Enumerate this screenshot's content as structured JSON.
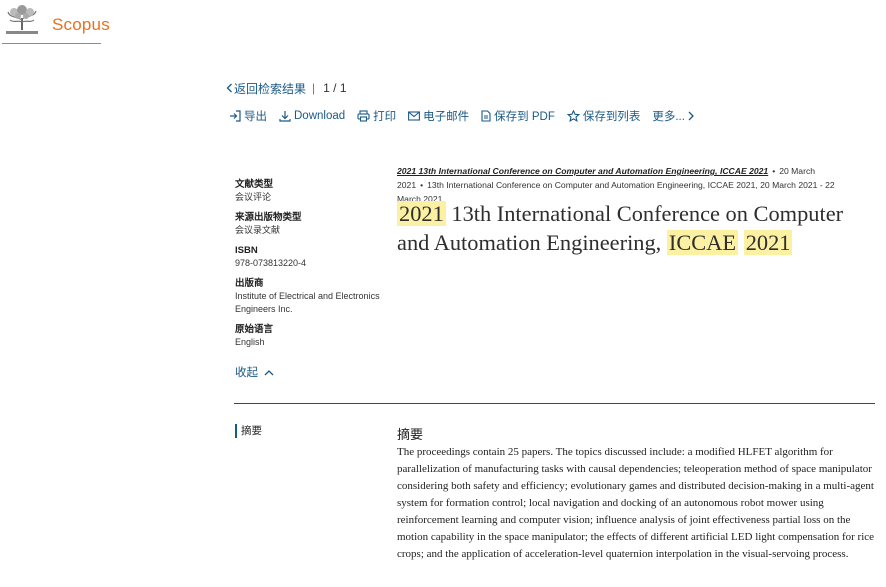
{
  "header": {
    "brand": "Scopus"
  },
  "nav": {
    "back_label": "返回检索结果",
    "pager": "1 / 1"
  },
  "toolbar": [
    {
      "name": "export-button",
      "icon": "export-icon",
      "label": "导出"
    },
    {
      "name": "download-button",
      "icon": "download-icon",
      "label": "Download"
    },
    {
      "name": "print-button",
      "icon": "print-icon",
      "label": "打印"
    },
    {
      "name": "email-button",
      "icon": "email-icon",
      "label": "电子邮件"
    },
    {
      "name": "save-pdf-button",
      "icon": "pdf-icon",
      "label": "保存到 PDF"
    },
    {
      "name": "save-list-button",
      "icon": "star-icon",
      "label": "保存到列表"
    },
    {
      "name": "more-button",
      "icon": "chevron-right-icon",
      "label": "更多..."
    }
  ],
  "meta": {
    "doc_type_label": "文献类型",
    "doc_type_value": "会议评论",
    "source_type_label": "来源出版物类型",
    "source_type_value": "会议录文献",
    "isbn_label": "ISBN",
    "isbn_value": "978-073813220-4",
    "publisher_label": "出版商",
    "publisher_value": "Institute of Electrical and Electronics Engineers Inc.",
    "language_label": "原始语言",
    "language_value": "English",
    "collapse_label": "收起"
  },
  "source": {
    "title": "2021 13th International Conference on Computer and Automation Engineering, ICCAE 2021",
    "date": "20 March 2021",
    "conference": "13th International Conference on Computer and Automation Engineering, ICCAE 2021, 20 March 2021 - 22 March 2021"
  },
  "title": {
    "hl1": "2021",
    "mid": " 13th International Conference on Computer and Automation Engineering, ",
    "hl2": "ICCAE",
    "hl3": "2021"
  },
  "abstract": {
    "tab_label": "摘要",
    "heading": "摘要",
    "text": "The proceedings contain 25 papers. The topics discussed include: a modified HLFET algorithm for parallelization of manufacturing tasks with causal dependencies; teleoperation method of space manipulator considering both safety and efficiency; evolutionary games and distributed decision-making in a multi-agent system for formation control; local navigation and docking of an autonomous robot mower using reinforcement learning and computer vision; influence analysis of joint effectiveness partial loss on the motion capability in the space manipulator; the effects of different artificial LED light compensation for rice crops; and the application of acceleration-level quaternion interpolation in the visual-servoing process."
  },
  "colors": {
    "brand": "#e9711c",
    "link": "#1a5a87",
    "highlight": "#fcf1a3"
  }
}
